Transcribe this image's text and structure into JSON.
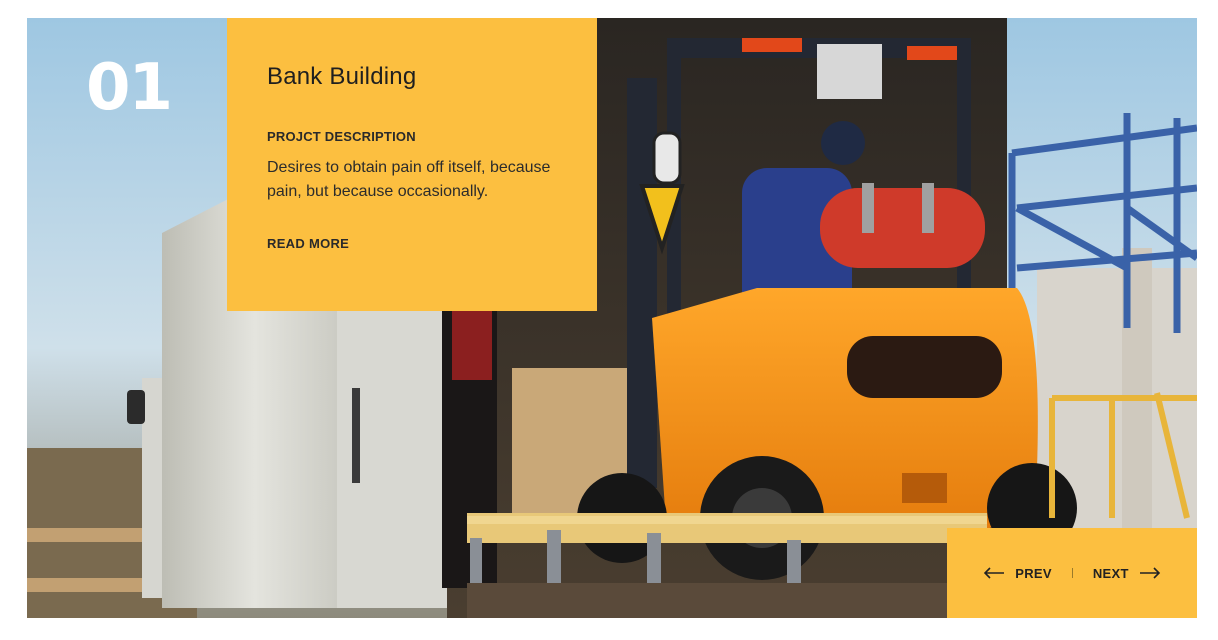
{
  "slide": {
    "number": "01",
    "title": "Bank Building",
    "description_label": "PROJCT DESCRIPTION",
    "description": "Desires to obtain pain off itself, because pain, but because occasionally.",
    "read_more": "READ MORE"
  },
  "nav": {
    "prev_label": "PREV",
    "next_label": "NEXT"
  },
  "colors": {
    "accent": "#fcbf40",
    "text_dark": "#222222",
    "number": "#ffffff"
  },
  "icons": {
    "prev": "arrow-left-icon",
    "next": "arrow-right-icon"
  }
}
